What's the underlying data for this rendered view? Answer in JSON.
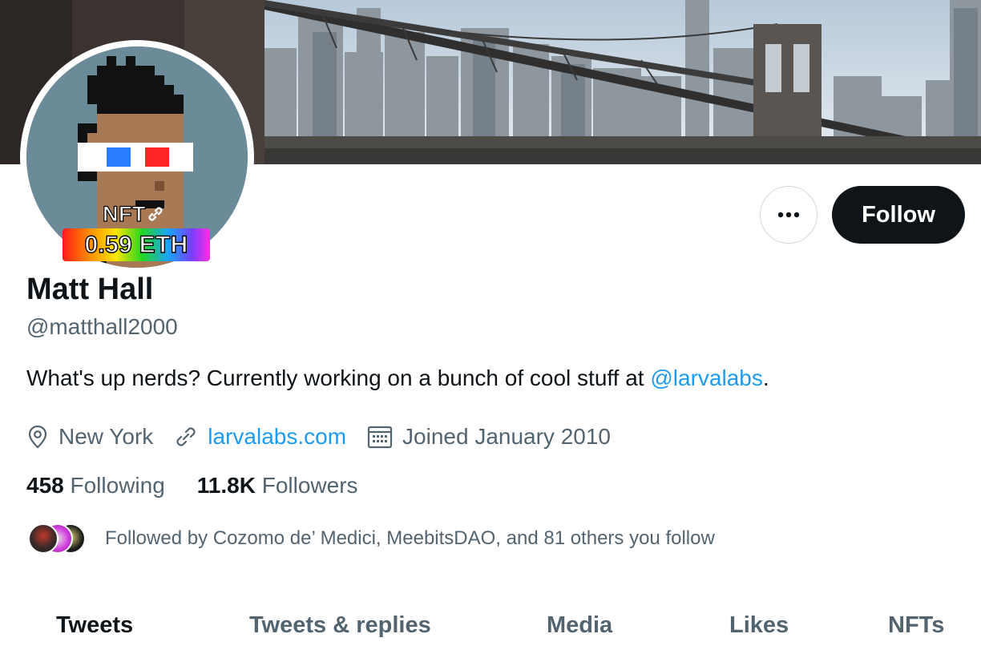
{
  "profile": {
    "display_name": "Matt Hall",
    "handle": "@matthall2000",
    "bio_text": "What's up nerds? Currently working on a bunch of cool stuff at ",
    "bio_mention": "@larvalabs",
    "bio_end": ".",
    "location": "New York",
    "website": "larvalabs.com",
    "joined": "Joined January 2010"
  },
  "avatar": {
    "nft_label": "NFT",
    "price": "0.59 ETH"
  },
  "actions": {
    "more_label": "•••",
    "follow_label": "Follow"
  },
  "stats": {
    "following_count": "458",
    "following_label": "Following",
    "followers_count": "11.8K",
    "followers_label": "Followers"
  },
  "followed_by": {
    "text": "Followed by Cozomo de’ Medici, MeebitsDAO, and 81 others you follow"
  },
  "tabs": [
    {
      "label": "Tweets",
      "active": true
    },
    {
      "label": "Tweets & replies",
      "active": false
    },
    {
      "label": "Media",
      "active": false
    },
    {
      "label": "Likes",
      "active": false
    },
    {
      "label": "NFTs",
      "active": false
    }
  ],
  "colors": {
    "accent": "#1d9bf0",
    "text_primary": "#0f1419",
    "text_secondary": "#536471",
    "follow_button": "#0f1419",
    "avatar_background": "#6b8b99"
  },
  "icons": {
    "location": "location-pin-icon",
    "website": "link-icon",
    "joined": "calendar-icon",
    "nft": "chain-link-icon",
    "more": "more-dots-icon"
  }
}
